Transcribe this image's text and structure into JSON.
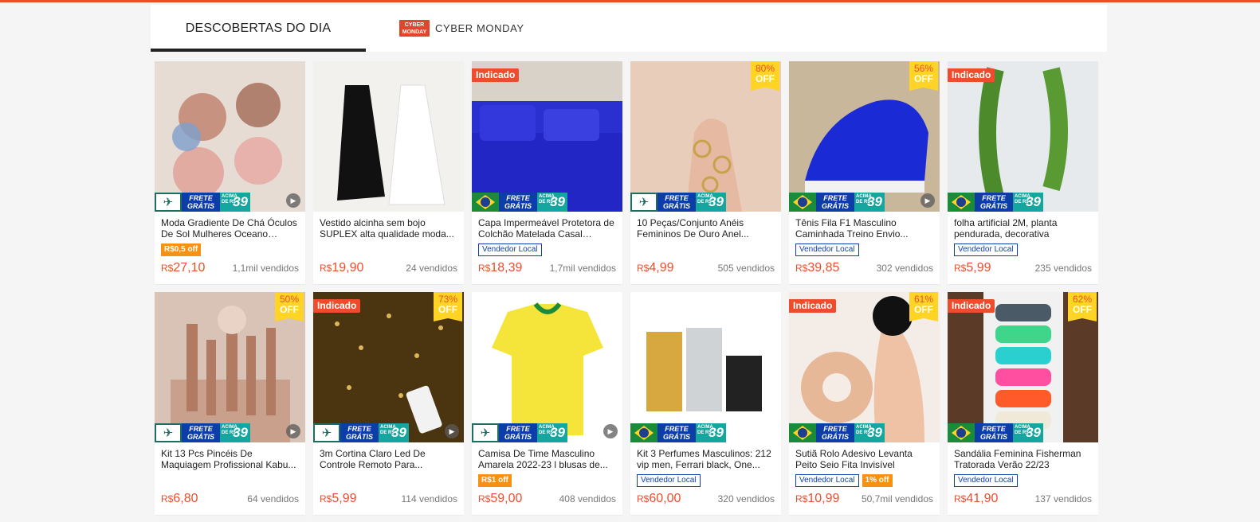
{
  "tabs": [
    {
      "label": "DESCOBERTAS DO DIA"
    },
    {
      "label": "CYBER MONDAY",
      "logo": "CYBER MONDAY"
    }
  ],
  "colors": {
    "accent": "#ee4d2d",
    "frete_blue": "#0d3ea8",
    "frete_teal": "#16a6a0",
    "off_yellow": "#ffd424",
    "voucher_orange": "#f69113"
  },
  "banner_text": {
    "frete": "FRETE GRÁTIS",
    "acima": "ACIMA DE R$",
    "value": "39"
  },
  "currency": "R$",
  "products": [
    {
      "title": "Moda Gradiente De Chá Óculos De Sol Mulheres Oceano Corte...",
      "price": "27,10",
      "sold": "1,1mil vendidos",
      "voucher": "R$0,5 off",
      "indicado": "",
      "discount": "",
      "banner": "plane",
      "video": true,
      "vendedor_local": "",
      "image": "sunglasses",
      "bg": "#e7dcd4"
    },
    {
      "title": "Vestido alcinha sem bojo SUPLEX alta qualidade moda...",
      "price": "19,90",
      "sold": "24 vendidos",
      "voucher": "",
      "indicado": "",
      "discount": "",
      "banner": "",
      "video": false,
      "vendedor_local": "",
      "image": "dresses",
      "bg": "#f3f1ee"
    },
    {
      "title": "Capa Impermeável Protetora de Colchão Matelada Casal Padrã...",
      "price": "18,39",
      "sold": "1,7mil vendidos",
      "voucher": "",
      "indicado": "Indicado",
      "discount": "",
      "banner": "flag",
      "video": false,
      "vendedor_local": "Vendedor Local",
      "image": "mattress",
      "bg": "#2a2fcf"
    },
    {
      "title": "10 Peças/Conjunto Anéis Femininos De Ouro Anel...",
      "price": "4,99",
      "sold": "505 vendidos",
      "voucher": "",
      "indicado": "",
      "discount": "80%",
      "banner": "plane",
      "video": false,
      "vendedor_local": "",
      "image": "rings",
      "bg": "#e9cdbb"
    },
    {
      "title": "Tênis Fila F1 Masculino Caminhada Treino Envio...",
      "price": "39,85",
      "sold": "302 vendidos",
      "voucher": "",
      "indicado": "",
      "discount": "56%",
      "banner": "flag",
      "video": true,
      "vendedor_local": "Vendedor Local",
      "image": "sneaker",
      "bg": "#c9b79c"
    },
    {
      "title": "folha artificial 2M, planta pendurada, decorativa",
      "price": "5,99",
      "sold": "235 vendidos",
      "voucher": "",
      "indicado": "Indicado",
      "discount": "",
      "banner": "flag",
      "video": false,
      "vendedor_local": "Vendedor Local",
      "image": "plant",
      "bg": "#eef1f2"
    },
    {
      "title": "Kit 13 Pcs Pincéis De Maquiagem Profissional Kabu...",
      "price": "6,80",
      "sold": "64 vendidos",
      "voucher": "",
      "indicado": "",
      "discount": "50%",
      "banner": "plane",
      "video": true,
      "vendedor_local": "",
      "image": "brushes",
      "bg": "#d9c3b6"
    },
    {
      "title": "3m Cortina Claro Led De Controle Remoto Para...",
      "price": "5,99",
      "sold": "114 vendidos",
      "voucher": "",
      "indicado": "Indicado",
      "discount": "73%",
      "banner": "plane",
      "video": true,
      "vendedor_local": "",
      "image": "lights",
      "bg": "#3a2a10"
    },
    {
      "title": "Camisa De Time Masculino Amarela 2022-23 l blusas de...",
      "price": "59,00",
      "sold": "408 vendidos",
      "voucher": "R$1 off",
      "indicado": "",
      "discount": "",
      "banner": "plane",
      "video": true,
      "vendedor_local": "",
      "image": "shirt",
      "bg": "#ffffff"
    },
    {
      "title": "Kit 3 Perfumes Masculinos: 212 vip men, Ferrari black, One...",
      "price": "60,00",
      "sold": "320 vendidos",
      "voucher": "",
      "indicado": "",
      "discount": "",
      "banner": "flag",
      "video": false,
      "vendedor_local": "Vendedor Local",
      "image": "perfume",
      "bg": "#ffffff"
    },
    {
      "title": "Sutiã Rolo Adesivo Levanta Peito Seio Fita Invisível",
      "price": "10,99",
      "sold": "50,7mil vendidos",
      "voucher": "1% off",
      "indicado": "Indicado",
      "discount": "61%",
      "banner": "flag",
      "video": false,
      "vendedor_local": "Vendedor Local",
      "image": "tape",
      "bg": "#f4ece6"
    },
    {
      "title": "Sandália Feminina Fisherman Tratorada Verão 22/23",
      "price": "41,90",
      "sold": "137 vendidos",
      "voucher": "",
      "indicado": "Indicado",
      "discount": "62%",
      "banner": "flag",
      "video": false,
      "vendedor_local": "Vendedor Local",
      "image": "sandals",
      "bg": "#5b3b28"
    }
  ]
}
